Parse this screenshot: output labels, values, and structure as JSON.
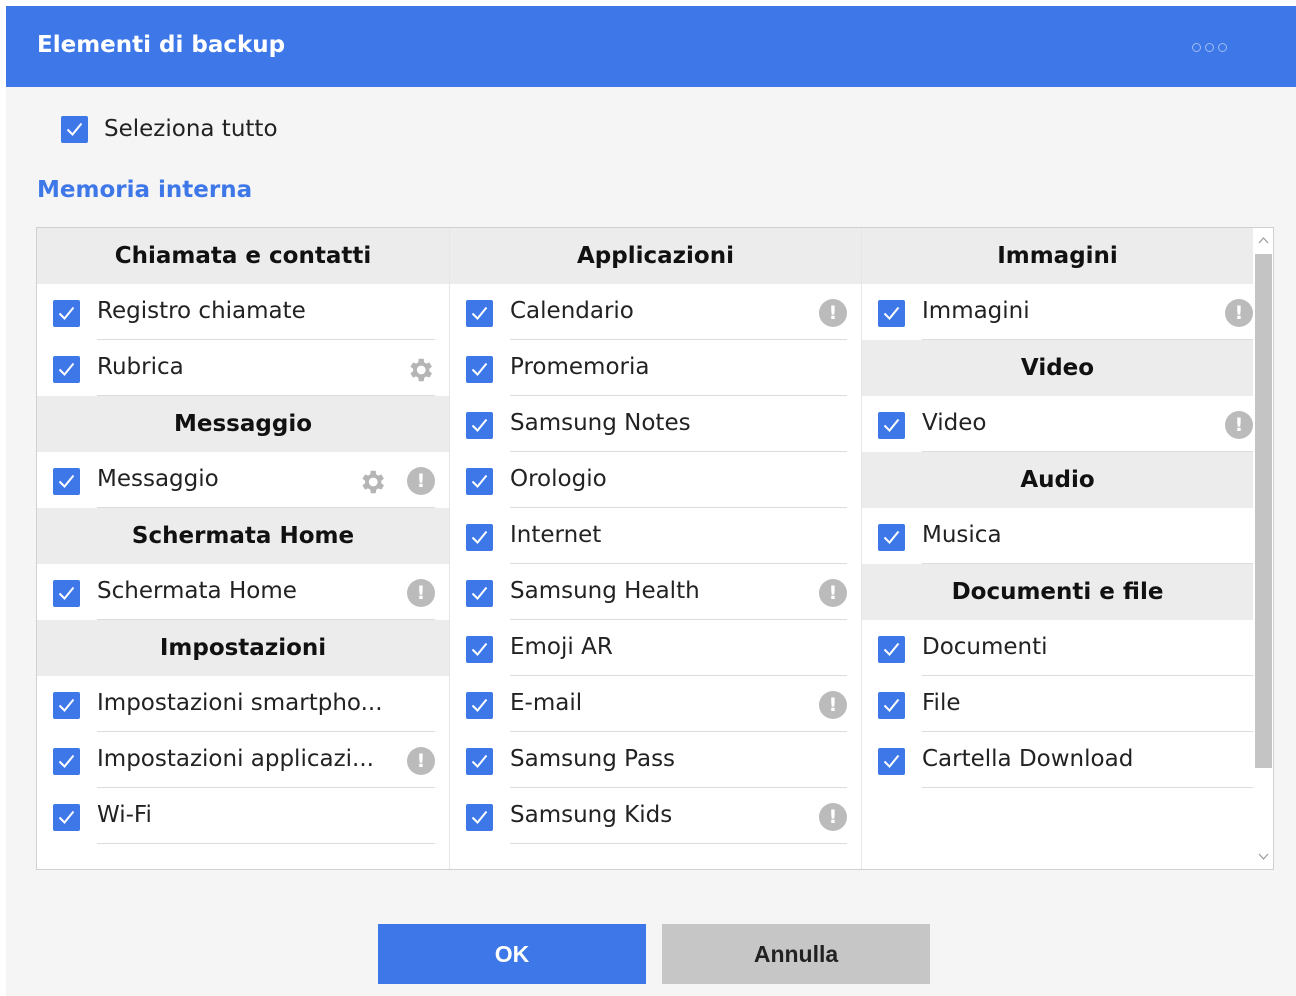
{
  "dialog": {
    "title": "Elementi di backup",
    "select_all_label": "Seleziona tutto",
    "section_title": "Memoria interna",
    "ok_label": "OK",
    "cancel_label": "Annulla",
    "accent_color": "#3d77e8"
  },
  "columns": [
    {
      "groups": [
        {
          "header": "Chiamata e contatti",
          "items": [
            {
              "label": "Registro chiamate",
              "checked": true,
              "icons": []
            },
            {
              "label": "Rubrica",
              "checked": true,
              "icons": [
                "gear-icon"
              ]
            }
          ]
        },
        {
          "header": "Messaggio",
          "items": [
            {
              "label": "Messaggio",
              "checked": true,
              "icons": [
                "gear-icon",
                "info-icon"
              ]
            }
          ]
        },
        {
          "header": "Schermata Home",
          "items": [
            {
              "label": "Schermata Home",
              "checked": true,
              "icons": [
                "info-icon"
              ]
            }
          ]
        },
        {
          "header": "Impostazioni",
          "items": [
            {
              "label": "Impostazioni smartpho...",
              "checked": true,
              "icons": []
            },
            {
              "label": "Impostazioni applicazi...",
              "checked": true,
              "icons": [
                "info-icon"
              ]
            },
            {
              "label": "Wi-Fi",
              "checked": true,
              "icons": []
            }
          ]
        }
      ]
    },
    {
      "groups": [
        {
          "header": "Applicazioni",
          "items": [
            {
              "label": "Calendario",
              "checked": true,
              "icons": [
                "info-icon"
              ]
            },
            {
              "label": "Promemoria",
              "checked": true,
              "icons": []
            },
            {
              "label": "Samsung Notes",
              "checked": true,
              "icons": []
            },
            {
              "label": "Orologio",
              "checked": true,
              "icons": []
            },
            {
              "label": "Internet",
              "checked": true,
              "icons": []
            },
            {
              "label": "Samsung Health",
              "checked": true,
              "icons": [
                "info-icon"
              ]
            },
            {
              "label": "Emoji AR",
              "checked": true,
              "icons": []
            },
            {
              "label": "E-mail",
              "checked": true,
              "icons": [
                "info-icon"
              ]
            },
            {
              "label": "Samsung Pass",
              "checked": true,
              "icons": []
            },
            {
              "label": "Samsung Kids",
              "checked": true,
              "icons": [
                "info-icon"
              ]
            }
          ]
        }
      ]
    },
    {
      "groups": [
        {
          "header": "Immagini",
          "items": [
            {
              "label": "Immagini",
              "checked": true,
              "icons": [
                "info-icon"
              ]
            }
          ]
        },
        {
          "header": "Video",
          "items": [
            {
              "label": "Video",
              "checked": true,
              "icons": [
                "info-icon"
              ]
            }
          ]
        },
        {
          "header": "Audio",
          "items": [
            {
              "label": "Musica",
              "checked": true,
              "icons": []
            }
          ]
        },
        {
          "header": "Documenti e file",
          "items": [
            {
              "label": "Documenti",
              "checked": true,
              "icons": []
            },
            {
              "label": "File",
              "checked": true,
              "icons": []
            },
            {
              "label": "Cartella Download",
              "checked": true,
              "icons": []
            }
          ]
        }
      ]
    }
  ]
}
